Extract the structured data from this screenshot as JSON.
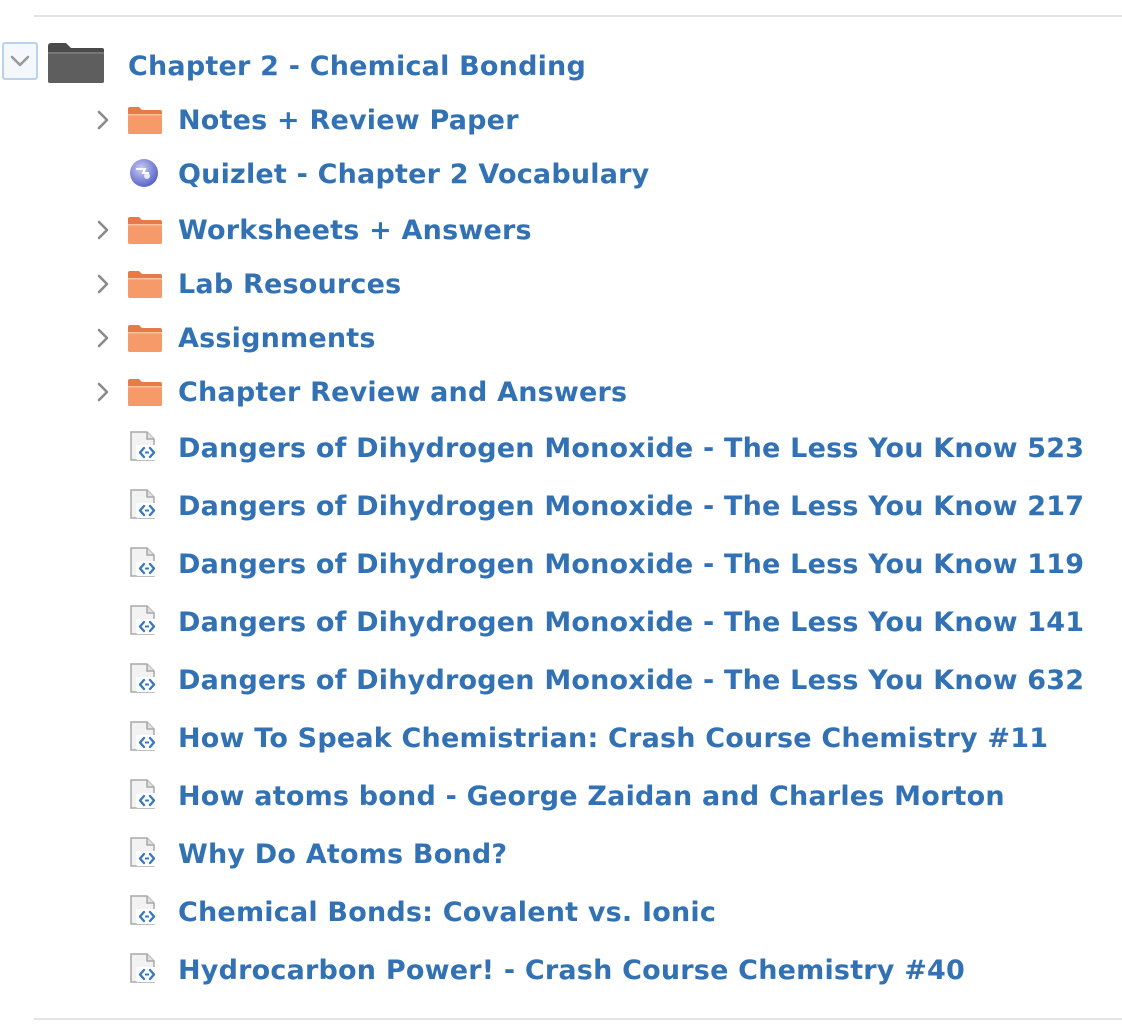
{
  "module": {
    "title": "Chapter 2 - Chemical Bonding",
    "expanded": true
  },
  "items": [
    {
      "type": "folder",
      "label": "Notes + Review Paper"
    },
    {
      "type": "quizlet",
      "label": "Quizlet - Chapter 2 Vocabulary"
    },
    {
      "type": "folder",
      "label": "Worksheets + Answers"
    },
    {
      "type": "folder",
      "label": "Lab Resources"
    },
    {
      "type": "folder",
      "label": "Assignments"
    },
    {
      "type": "folder",
      "label": "Chapter Review and Answers"
    },
    {
      "type": "embed",
      "label": "Dangers of Dihydrogen Monoxide - The Less You Know 523"
    },
    {
      "type": "embed",
      "label": "Dangers of Dihydrogen Monoxide - The Less You Know 217"
    },
    {
      "type": "embed",
      "label": "Dangers of Dihydrogen Monoxide - The Less You Know 119"
    },
    {
      "type": "embed",
      "label": "Dangers of Dihydrogen Monoxide - The Less You Know 141"
    },
    {
      "type": "embed",
      "label": "Dangers of Dihydrogen Monoxide - The Less You Know 632"
    },
    {
      "type": "embed",
      "label": "How To Speak Chemistrian: Crash Course Chemistry #11"
    },
    {
      "type": "embed",
      "label": "How atoms bond - George Zaidan and Charles Morton"
    },
    {
      "type": "embed",
      "label": "Why Do Atoms Bond?"
    },
    {
      "type": "embed",
      "label": "Chemical Bonds: Covalent vs. Ionic"
    },
    {
      "type": "embed",
      "label": "Hydrocarbon Power! - Crash Course Chemistry #40"
    }
  ],
  "colors": {
    "link": "#3272b4",
    "folder_orange": "#f4925a",
    "folder_dark": "#555555",
    "divider": "#e3e3e3"
  },
  "icons": {
    "collapse": "chevron-down-icon",
    "module": "folder-dark-icon",
    "folder": "folder-orange-icon",
    "quizlet": "quizlet-icon",
    "embed": "embed-code-icon",
    "expand": "chevron-right-icon"
  }
}
